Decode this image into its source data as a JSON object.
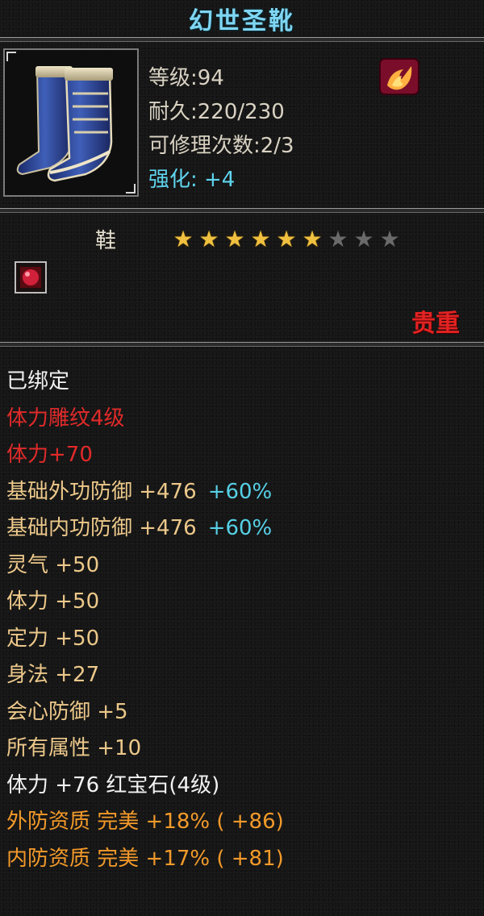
{
  "item": {
    "name": "幻世圣靴",
    "level_line": "等级:94",
    "durability_line": "耐久:220/230",
    "repair_line": "可修理次数:2/3",
    "enhance_line": "强化: +4",
    "slot_type": "鞋",
    "stars_total": 9,
    "stars_filled": 6,
    "rarity": "贵重"
  },
  "attributes": [
    {
      "text": "已绑定",
      "pct": "",
      "color": "#f2f2f2"
    },
    {
      "text": "体力雕纹4级",
      "pct": "",
      "color": "#e02a2a"
    },
    {
      "text": "体力+70",
      "pct": "",
      "color": "#e02a2a"
    },
    {
      "text": "基础外功防御 +476",
      "pct": "+60%",
      "color": "#ecc88a"
    },
    {
      "text": "基础内功防御 +476",
      "pct": "+60%",
      "color": "#ecc88a"
    },
    {
      "text": "灵气 +50",
      "pct": "",
      "color": "#ecc88a"
    },
    {
      "text": "体力 +50",
      "pct": "",
      "color": "#ecc88a"
    },
    {
      "text": "定力 +50",
      "pct": "",
      "color": "#ecc88a"
    },
    {
      "text": "身法 +27",
      "pct": "",
      "color": "#ecc88a"
    },
    {
      "text": "会心防御 +5",
      "pct": "",
      "color": "#ecc88a"
    },
    {
      "text": "所有属性 +10",
      "pct": "",
      "color": "#ecc88a"
    },
    {
      "text": "体力 +76 红宝石(4级)",
      "pct": "",
      "color": "#f2f2f2"
    },
    {
      "text": "外防资质 完美 +18% ( +86)",
      "pct": "",
      "color": "#f39a2a"
    },
    {
      "text": "内防资质 完美 +17% ( +81)",
      "pct": "",
      "color": "#f39a2a"
    }
  ],
  "icons": {
    "item_icon": "blue-boots-icon",
    "badge_icon": "flame-emblem-icon",
    "gem_icon": "red-gem-icon",
    "star_icon": "star-icon"
  },
  "colors": {
    "title": "#7fd6f2",
    "rarity": "#e32222",
    "star_on": "#f0c040",
    "star_off": "#6a6a6a",
    "percent": "#56d0e6"
  }
}
